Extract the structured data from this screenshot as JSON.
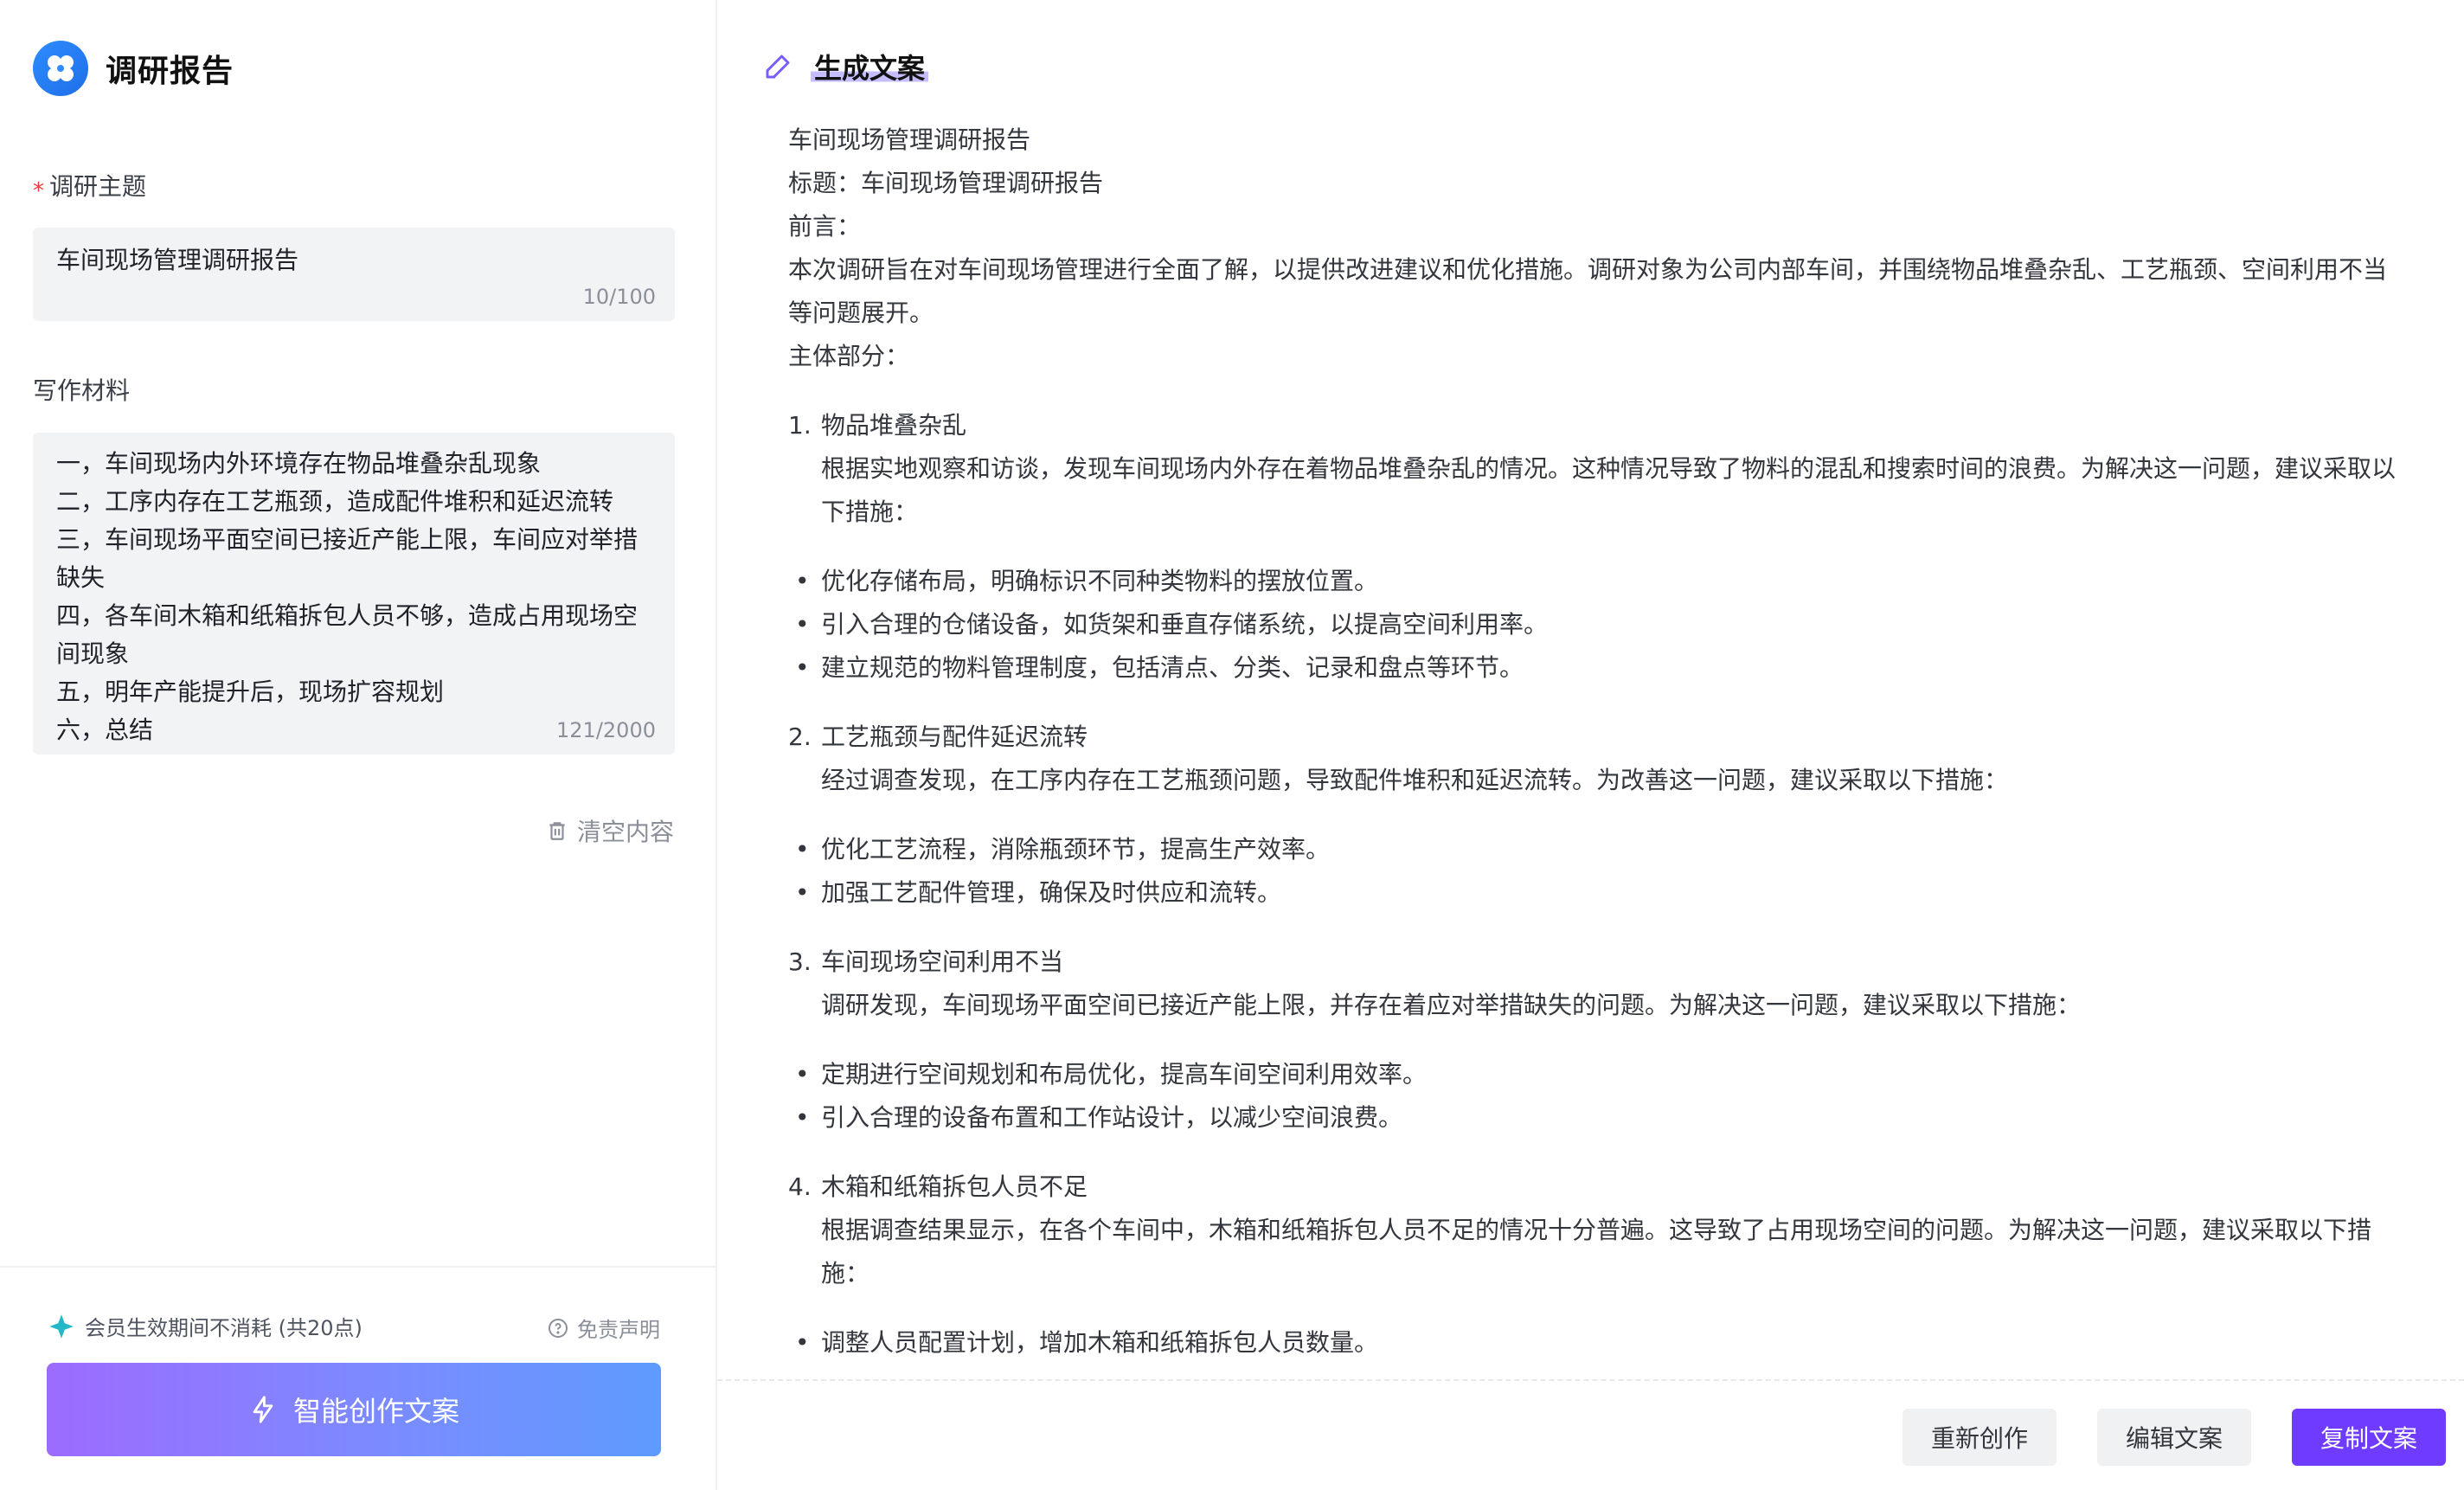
{
  "app": {
    "title": "调研报告"
  },
  "form": {
    "topic": {
      "label": "调研主题",
      "required_mark": "*",
      "value": "车间现场管理调研报告",
      "counter": "10/100"
    },
    "material": {
      "label": "写作材料",
      "lines": [
        "一，车间现场内外环境存在物品堆叠杂乱现象",
        "二，工序内存在工艺瓶颈，造成配件堆积和延迟流转",
        "三，车间现场平面空间已接近产能上限，车间应对举措缺失",
        "四，各车间木箱和纸箱拆包人员不够，造成占用现场空间现象",
        "五，明年产能提升后，现场扩容规划",
        "六，总结"
      ],
      "counter": "121/2000"
    },
    "clear_label": "清空内容"
  },
  "footer": {
    "member_note": "会员生效期间不消耗 (共20点)",
    "disclaimer": "免责声明",
    "create_button": "智能创作文案"
  },
  "result": {
    "heading": "生成文案",
    "intro_lines": [
      "车间现场管理调研报告",
      "标题：车间现场管理调研报告",
      "前言：",
      "本次调研旨在对车间现场管理进行全面了解，以提供改进建议和优化措施。调研对象为公司内部车间，并围绕物品堆叠杂乱、工艺瓶颈、空间利用不当等问题展开。",
      "主体部分："
    ],
    "sections": [
      {
        "num": "1.",
        "title": "物品堆叠杂乱",
        "body": "根据实地观察和访谈，发现车间现场内外存在着物品堆叠杂乱的情况。这种情况导致了物料的混乱和搜索时间的浪费。为解决这一问题，建议采取以下措施：",
        "bullets": [
          "优化存储布局，明确标识不同种类物料的摆放位置。",
          "引入合理的仓储设备，如货架和垂直存储系统，以提高空间利用率。",
          "建立规范的物料管理制度，包括清点、分类、记录和盘点等环节。"
        ]
      },
      {
        "num": "2.",
        "title": "工艺瓶颈与配件延迟流转",
        "body": "经过调查发现，在工序内存在工艺瓶颈问题，导致配件堆积和延迟流转。为改善这一问题，建议采取以下措施：",
        "bullets": [
          "优化工艺流程，消除瓶颈环节，提高生产效率。",
          "加强工艺配件管理，确保及时供应和流转。"
        ]
      },
      {
        "num": "3.",
        "title": "车间现场空间利用不当",
        "body": "调研发现，车间现场平面空间已接近产能上限，并存在着应对举措缺失的问题。为解决这一问题，建议采取以下措施：",
        "bullets": [
          "定期进行空间规划和布局优化，提高车间空间利用效率。",
          "引入合理的设备布置和工作站设计，以减少空间浪费。"
        ]
      },
      {
        "num": "4.",
        "title": "木箱和纸箱拆包人员不足",
        "body": "根据调查结果显示，在各个车间中，木箱和纸箱拆包人员不足的情况十分普遍。这导致了占用现场空间的问题。为解决这一问题，建议采取以下措施：",
        "bullets": [
          "调整人员配置计划，增加木箱和纸箱拆包人员数量。"
        ]
      }
    ],
    "bullet_glyph": "•"
  },
  "actions": {
    "regenerate": "重新创作",
    "edit": "编辑文案",
    "copy": "复制文案"
  },
  "colors": {
    "primary": "#6f3cff",
    "gradient_start": "#9d6bff",
    "gradient_end": "#5e9bff",
    "logo_blue": "#2e8cff",
    "required": "#e83a3a"
  }
}
